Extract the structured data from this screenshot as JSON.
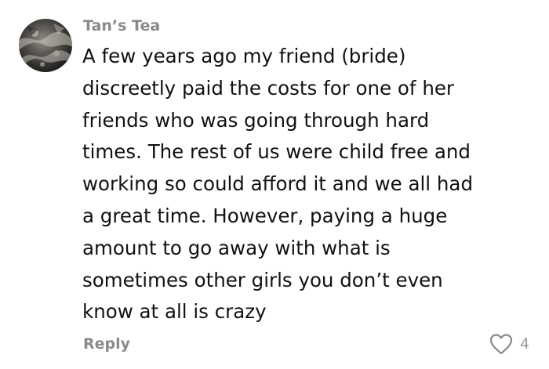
{
  "comment": {
    "author": "Tan’s Tea",
    "lines": [
      "A few years ago my friend (bride)",
      "discreetly paid the costs for one of her",
      "friends who was going through hard",
      "times. The rest of us were child free and",
      "working so could afford it and we all had",
      "a great time. However, paying a huge",
      "amount to go away with what is",
      "sometimes other girls you don’t even",
      "know at all is crazy"
    ],
    "reply_label": "Reply",
    "like_count": "4",
    "avatar_icon": "user-avatar-photo",
    "like_icon": "heart-outline-icon"
  },
  "colors": {
    "meta_text": "#8a8a8a",
    "body_text": "#111111",
    "background": "#ffffff"
  }
}
